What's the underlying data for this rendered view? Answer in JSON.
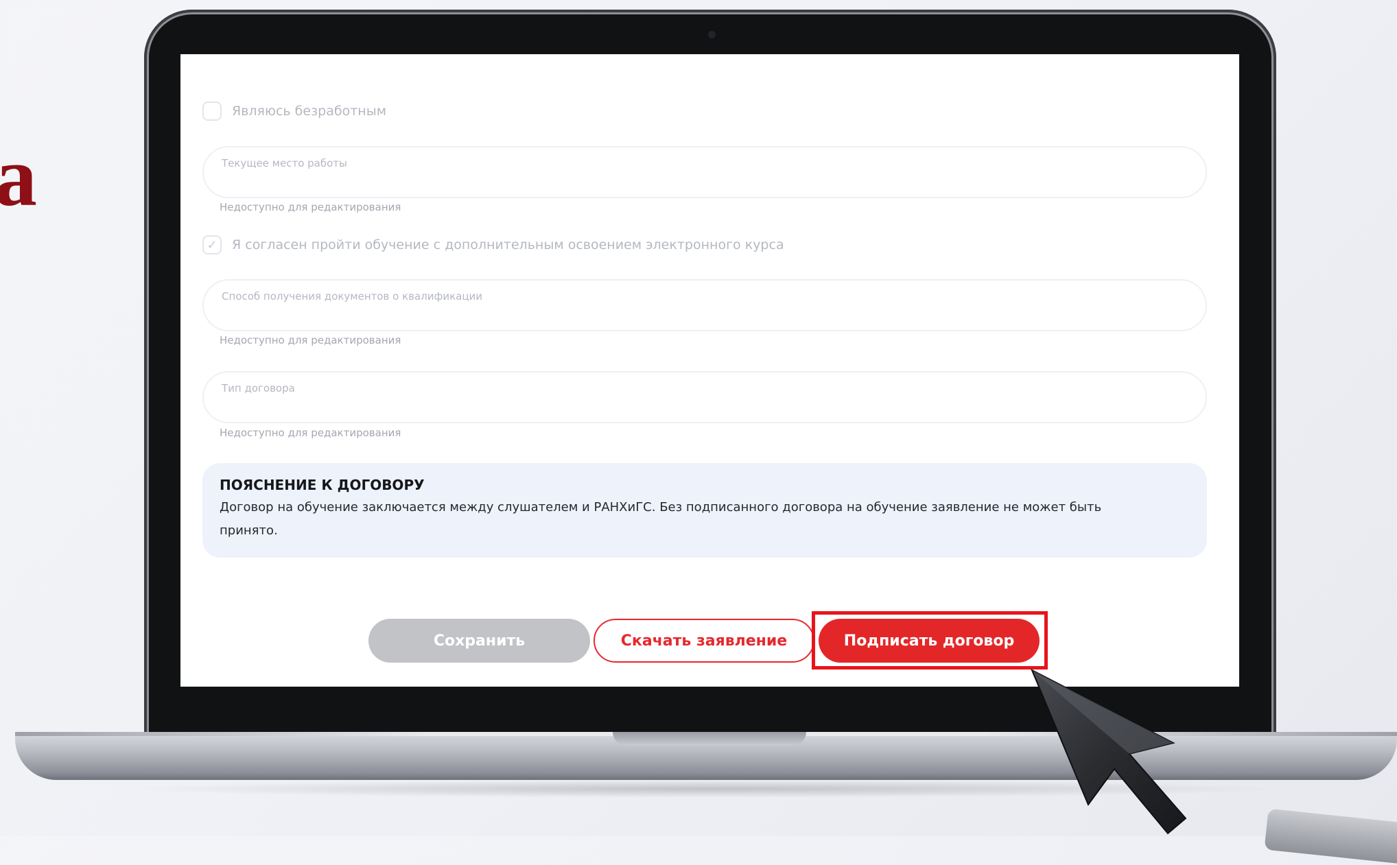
{
  "slide": {
    "heading_fragment": "а"
  },
  "form": {
    "unemployed_checkbox": {
      "label": "Являюсь безработным",
      "checked": false
    },
    "workplace_field": {
      "label": "Текущее место работы",
      "value": "",
      "note": "Недоступно для редактирования"
    },
    "ecourse_checkbox": {
      "label": "Я согласен пройти обучение с дополнительным освоением электронного курса",
      "checked": true
    },
    "documents_field": {
      "label": "Способ получения документов о квалификации",
      "value": "",
      "note": "Недоступно для редактирования"
    },
    "contract_type_field": {
      "label": "Тип договора",
      "value": "",
      "note": "Недоступно для редактирования"
    },
    "contract_note": {
      "title": "ПОЯСНЕНИЕ К ДОГОВОРУ",
      "text": "Договор на обучение заключается между слушателем и РАНХиГС. Без подписанного договора на обучение заявление не может быть принято."
    }
  },
  "buttons": {
    "save": "Сохранить",
    "download": "Скачать заявление",
    "sign": "Подписать договор"
  },
  "colors": {
    "accent_red": "#e32728",
    "highlight_red": "#e8141b",
    "disabled_gray": "#c2c3c6",
    "note_background": "#eef2fb",
    "slide_heading": "#8e0f16"
  },
  "icons": {
    "checkmark": "check-icon",
    "cursor": "mouse-pointer-icon"
  }
}
